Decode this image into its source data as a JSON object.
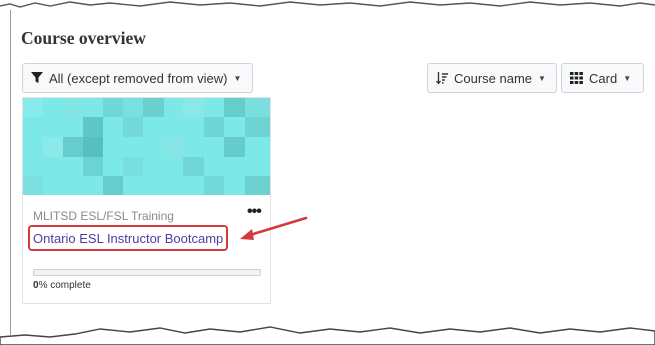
{
  "header": {
    "title": "Course overview"
  },
  "toolbar": {
    "filter_label": "All (except removed from view)",
    "sort_label": "Course name",
    "view_label": "Card"
  },
  "course": {
    "category": "MLITSD ESL/FSL Training",
    "name": "Ontario ESL Instructor Bootcamp",
    "progress_value": "0",
    "progress_suffix": "% complete",
    "progress_fraction": 0.0
  },
  "colors": {
    "accent_link": "#4a3f9c",
    "annotation_red": "#d33a3a",
    "card_pattern_base": "#7de8e8"
  },
  "icons": [
    "funnel-icon",
    "sort-icon",
    "grid-icon",
    "caret-down-icon",
    "more-options-icon",
    "annotation-arrow-icon"
  ]
}
